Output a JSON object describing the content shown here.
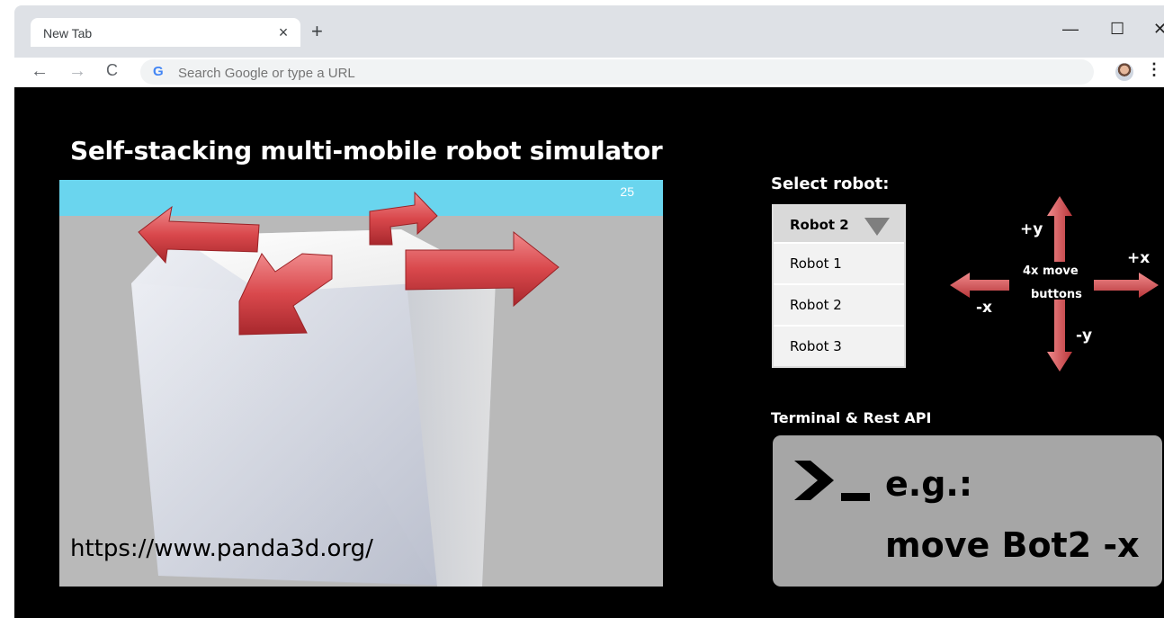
{
  "browser": {
    "tab_title": "New Tab",
    "tab_close": "×",
    "new_tab": "+",
    "minimize": "—",
    "maximize": "☐",
    "close": "✕",
    "back": "←",
    "forward": "→",
    "reload": "C",
    "google_icon": "G",
    "omnibox_placeholder": "Search Google or type a URL",
    "menu": "⋮"
  },
  "simulator": {
    "title": "Self-stacking multi-mobile robot simulator",
    "fps_counter": "25",
    "source_url": "https://www.panda3d.org/"
  },
  "robot_select": {
    "label": "Select robot:",
    "selected": "Robot 2",
    "options": [
      "Robot 1",
      "Robot 2",
      "Robot 3"
    ]
  },
  "move_buttons": {
    "center_label_line1": "4x move",
    "center_label_line2": "buttons",
    "plus_y": "+y",
    "minus_y": "-y",
    "plus_x": "+x",
    "minus_x": "-x"
  },
  "terminal": {
    "label": "Terminal & Rest API",
    "line1": "e.g.:",
    "line2": "move Bot2 -x"
  },
  "colors": {
    "sky": "#6ad5ee",
    "arrow_red": "#d9484c",
    "terminal_bg": "#a6a6a6",
    "page_bg": "#000000"
  }
}
